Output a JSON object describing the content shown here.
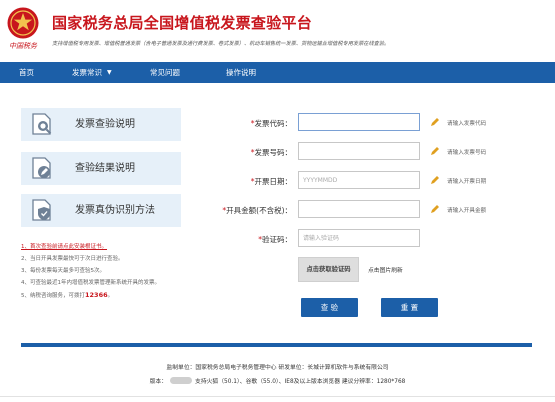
{
  "header": {
    "logo_caption": "中国税务",
    "title": "国家税务总局全国增值税发票查验平台",
    "subtitle": "支持增值税专用发票、增值税普通发票（含电子普通发票及通行费发票、卷式发票）、机动车销售统一发票、货物运输业增值税专用发票在线查验。"
  },
  "nav": {
    "home": "首页",
    "invoice_knowledge": "发票常识",
    "faq": "常见问题",
    "operation_guide": "操作说明"
  },
  "help_cards": [
    {
      "label": "发票查验说明"
    },
    {
      "label": "查验结果说明"
    },
    {
      "label": "发票真伪识别方法"
    }
  ],
  "notes": {
    "n1": "1、首次查验前请点此安装根证书。",
    "n2": "2、当日开具发票最快可于次日进行查验。",
    "n3": "3、每份发票每天最多可查验5次。",
    "n4": "4、可查验最近1年内增值税发票管理新系统开具的发票。",
    "n5_prefix": "5、纳税咨询服务，可拨打",
    "n5_number": "12366",
    "n5_suffix": "。"
  },
  "form": {
    "code_label": "发票代码：",
    "code_value": "",
    "code_hint": "请输入发票代码",
    "number_label": "发票号码：",
    "number_value": "",
    "number_hint": "请输入发票号码",
    "date_label": "开票日期：",
    "date_placeholder": "YYYYMMDD",
    "date_hint": "请输入开票日期",
    "amount_label": "开具金额(不含税)：",
    "amount_value": "",
    "amount_hint": "请输入开具金额",
    "captcha_label": "验证码：",
    "captcha_placeholder": "请输入验证码",
    "captcha_button": "点击获取验证码",
    "captcha_refresh": "点击图片刷新",
    "required_mark": "*"
  },
  "buttons": {
    "verify": "查 验",
    "reset": "重 置"
  },
  "footer": {
    "line1": "监制单位：国家税务总局电子税务管理中心     研发单位：长城计算机软件与系统有限公司",
    "version_label": "版本：",
    "line2": "支持火狐（50.1）、谷歌（55.0）、IE8及以上版本浏览器    建议分辨率：1280*768"
  },
  "colors": {
    "brand_red": "#c8161d",
    "nav_blue": "#1c5fa8",
    "card_bg": "#e6f0f9",
    "pencil": "#e0a020"
  },
  "icons": {
    "card1": "document-search-icon",
    "card2": "document-edit-icon",
    "card3": "document-shield-icon",
    "field": "pencil-icon",
    "nav_caret": "caret-down-icon",
    "logo": "tax-emblem-icon"
  }
}
